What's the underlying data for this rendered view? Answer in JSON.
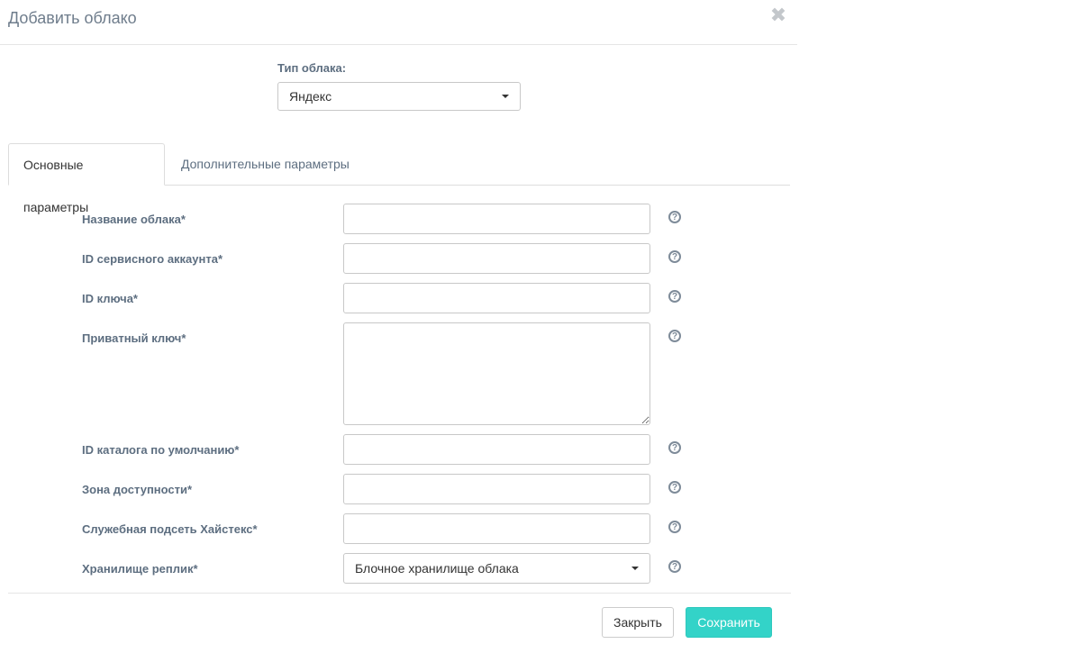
{
  "dialog": {
    "title": "Добавить облако",
    "close_symbol": "✖"
  },
  "cloud_type": {
    "label": "Тип облака:",
    "selected": "Яндекс"
  },
  "tabs": [
    {
      "label": "Основные параметры",
      "active": true
    },
    {
      "label": "Дополнительные параметры",
      "active": false
    }
  ],
  "fields": {
    "cloud_name": {
      "label": "Название облака*",
      "value": ""
    },
    "service_account_id": {
      "label": "ID сервисного аккаунта*",
      "value": ""
    },
    "key_id": {
      "label": "ID ключа*",
      "value": ""
    },
    "private_key": {
      "label": "Приватный ключ*",
      "value": ""
    },
    "default_folder_id": {
      "label": "ID каталога по умолчанию*",
      "value": ""
    },
    "availability_zone": {
      "label": "Зона доступности*",
      "value": ""
    },
    "service_subnet": {
      "label": "Служебная подсеть Хайстекс*",
      "value": ""
    },
    "replica_storage": {
      "label": "Хранилище реплик*",
      "selected": "Блочное хранилище облака"
    }
  },
  "help_symbol": "?",
  "footer": {
    "close_label": "Закрыть",
    "save_label": "Сохранить"
  },
  "colors": {
    "primary": "#33d3c8",
    "label": "#5d6e80",
    "title": "#6f7d8c"
  }
}
